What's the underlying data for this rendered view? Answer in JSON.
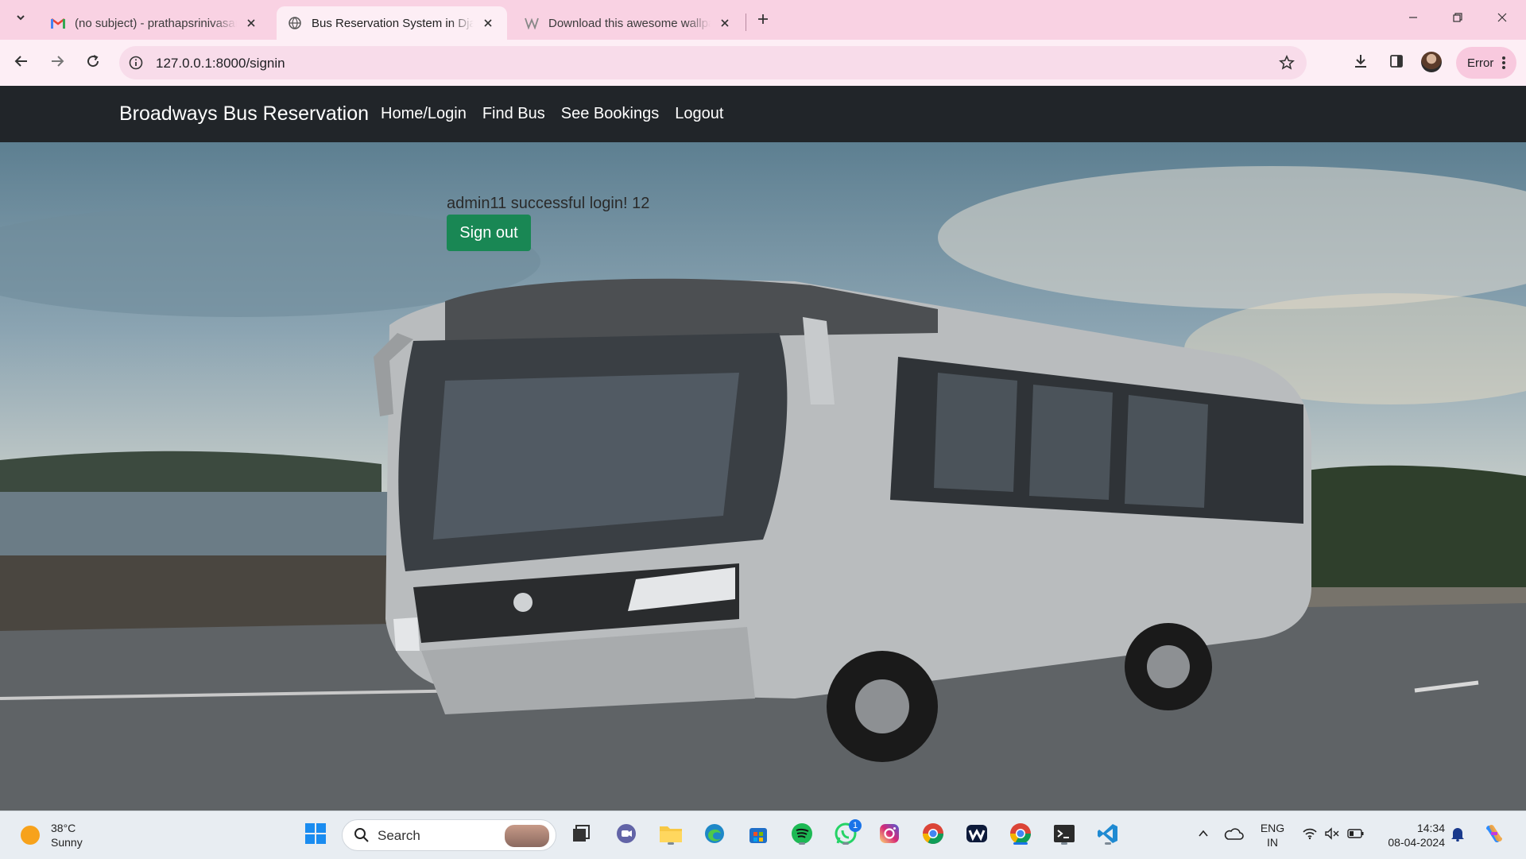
{
  "browser": {
    "tabs": [
      {
        "title": "(no subject) - prathapsrinivasan",
        "favicon": "gmail-icon",
        "active": false
      },
      {
        "title": "Bus Reservation System in Django",
        "favicon": "globe-icon",
        "active": true
      },
      {
        "title": "Download this awesome wallpaper",
        "favicon": "wallpaper-icon",
        "active": false
      }
    ],
    "url": "127.0.0.1:8000/signin",
    "profile_status": "Error"
  },
  "site": {
    "brand": "Broadways Bus Reservation",
    "nav": [
      {
        "label": "Home/Login"
      },
      {
        "label": "Find Bus"
      },
      {
        "label": "See Bookings"
      },
      {
        "label": "Logout"
      }
    ],
    "message": "admin11 successful login! 12",
    "signout_label": "Sign out",
    "signout_color": "#198754"
  },
  "taskbar": {
    "weather_temp": "38°C",
    "weather_desc": "Sunny",
    "search_label": "Search",
    "whatsapp_badge": "1",
    "lang_top": "ENG",
    "lang_bottom": "IN",
    "time": "14:34",
    "date": "08-04-2024"
  },
  "colors": {
    "tabstrip": "#f9d2e3",
    "toolbar": "#fdeef5",
    "navbar": "#212529"
  }
}
